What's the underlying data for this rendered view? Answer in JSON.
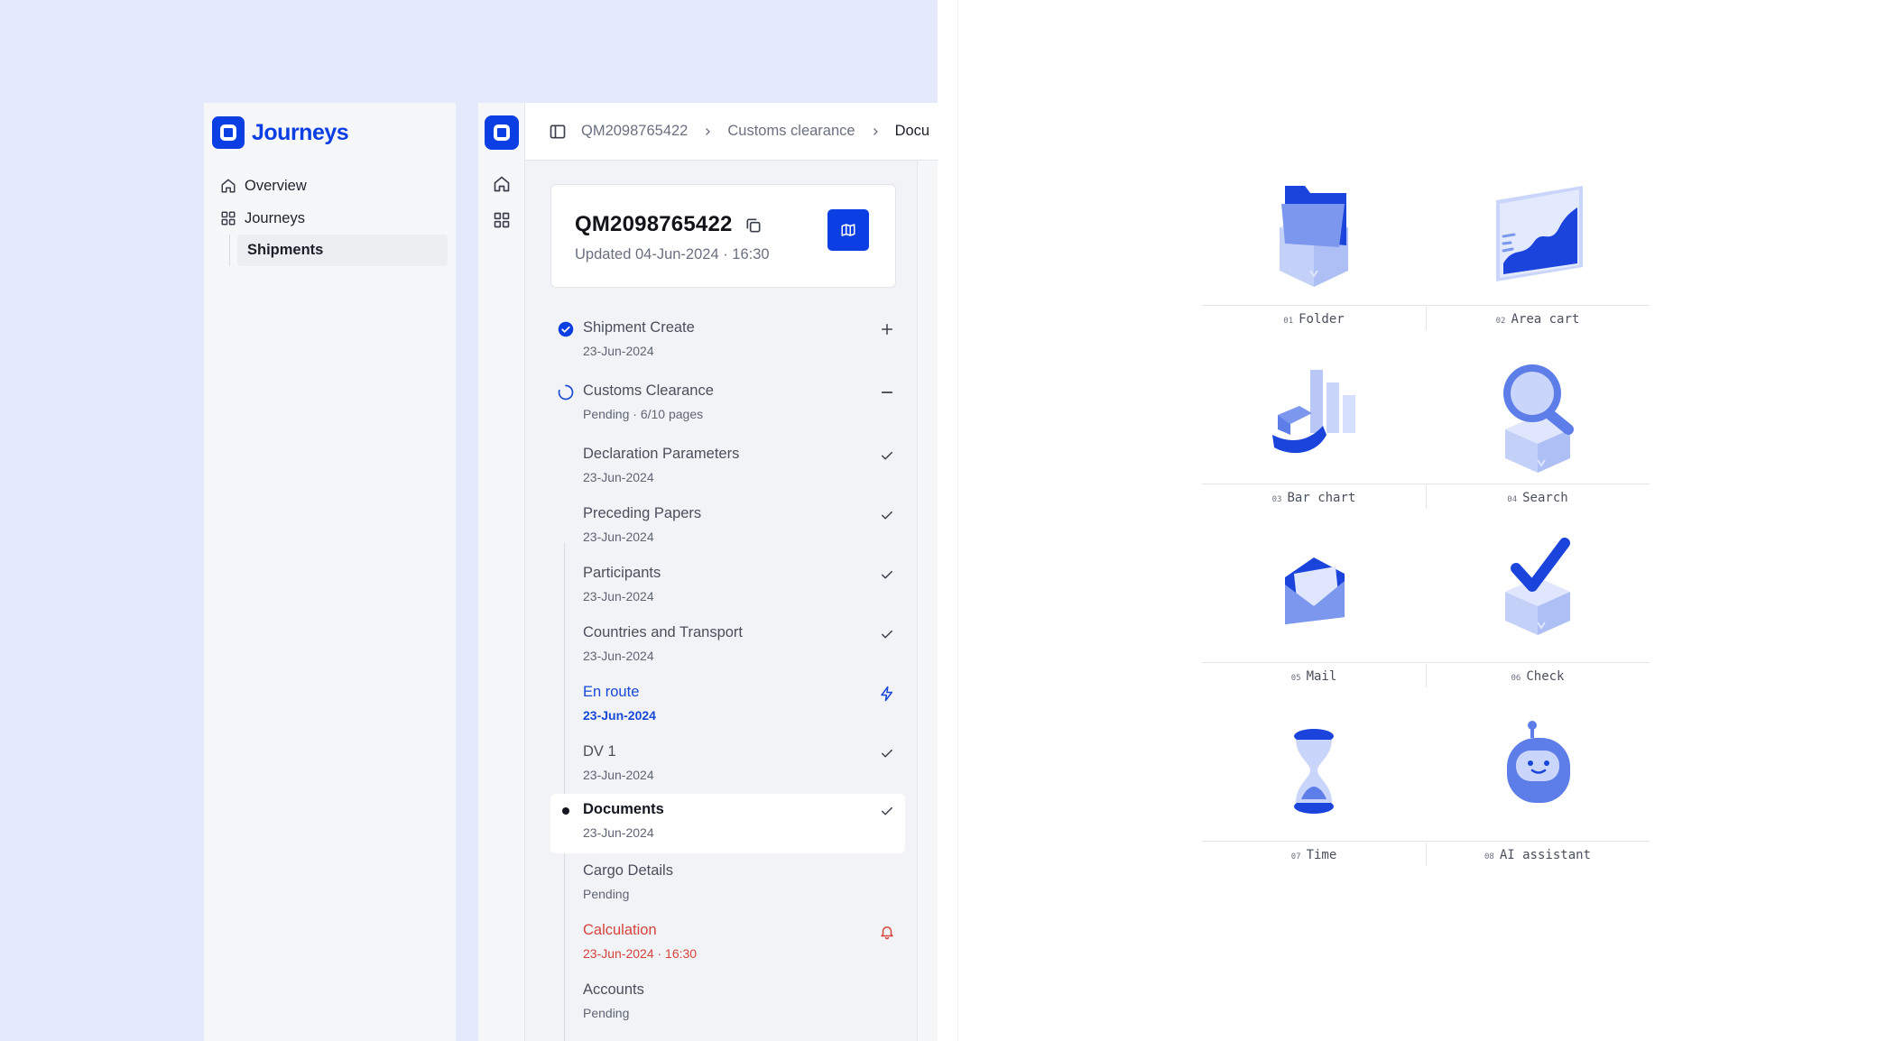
{
  "brand": {
    "name": "Journeys"
  },
  "sidebar": {
    "items": [
      {
        "label": "Overview",
        "icon": "home-icon"
      },
      {
        "label": "Journeys",
        "icon": "grid-icon"
      }
    ],
    "sub_items": [
      {
        "label": "Shipments"
      }
    ]
  },
  "rail": {
    "icons": [
      "home-icon",
      "grid-icon"
    ]
  },
  "breadcrumb": {
    "items": [
      "QM2098765422",
      "Customs clearance",
      "Docu"
    ]
  },
  "shipment": {
    "id": "QM2098765422",
    "updated": "Updated 04-Jun-2024 · 16:30"
  },
  "steps": [
    {
      "title": "Shipment Create",
      "date": "23-Jun-2024",
      "status": "done",
      "action": "plus"
    },
    {
      "title": "Customs Clearance",
      "date": "Pending · 6/10 pages",
      "status": "in-progress",
      "action": "minus"
    },
    {
      "title": "Declaration Parameters",
      "date": "23-Jun-2024",
      "action": "check"
    },
    {
      "title": "Preceding Papers",
      "date": "23-Jun-2024",
      "action": "check"
    },
    {
      "title": "Participants",
      "date": "23-Jun-2024",
      "action": "check"
    },
    {
      "title": "Countries and Transport",
      "date": "23-Jun-2024",
      "action": "check"
    },
    {
      "title": "En route",
      "date": "23-Jun-2024",
      "action": "bolt"
    },
    {
      "title": "DV 1",
      "date": "23-Jun-2024",
      "action": "check"
    },
    {
      "title": "Documents",
      "date": "23-Jun-2024",
      "action": "check"
    },
    {
      "title": "Cargo Details",
      "date": "Pending",
      "action": ""
    },
    {
      "title": "Calculation",
      "date": "23-Jun-2024 · 16:30",
      "action": "bell"
    },
    {
      "title": "Accounts",
      "date": "Pending",
      "action": ""
    }
  ],
  "icon_sheet": [
    {
      "num": "01",
      "label": "Folder",
      "icon": "folder-icon"
    },
    {
      "num": "02",
      "label": "Area cart",
      "icon": "area-chart-icon"
    },
    {
      "num": "03",
      "label": "Bar chart",
      "icon": "bar-chart-icon"
    },
    {
      "num": "04",
      "label": "Search",
      "icon": "search-icon"
    },
    {
      "num": "05",
      "label": "Mail",
      "icon": "mail-icon"
    },
    {
      "num": "06",
      "label": "Check",
      "icon": "check-icon"
    },
    {
      "num": "07",
      "label": "Time",
      "icon": "hourglass-icon"
    },
    {
      "num": "08",
      "label": "AI assistant",
      "icon": "robot-icon"
    }
  ],
  "colors": {
    "brand_blue": "#0b3ee3",
    "link_blue": "#1748d6",
    "alert_red": "#d6433b",
    "background_tint": "#e4e9fb",
    "icon_light": "#b8c7f6"
  }
}
